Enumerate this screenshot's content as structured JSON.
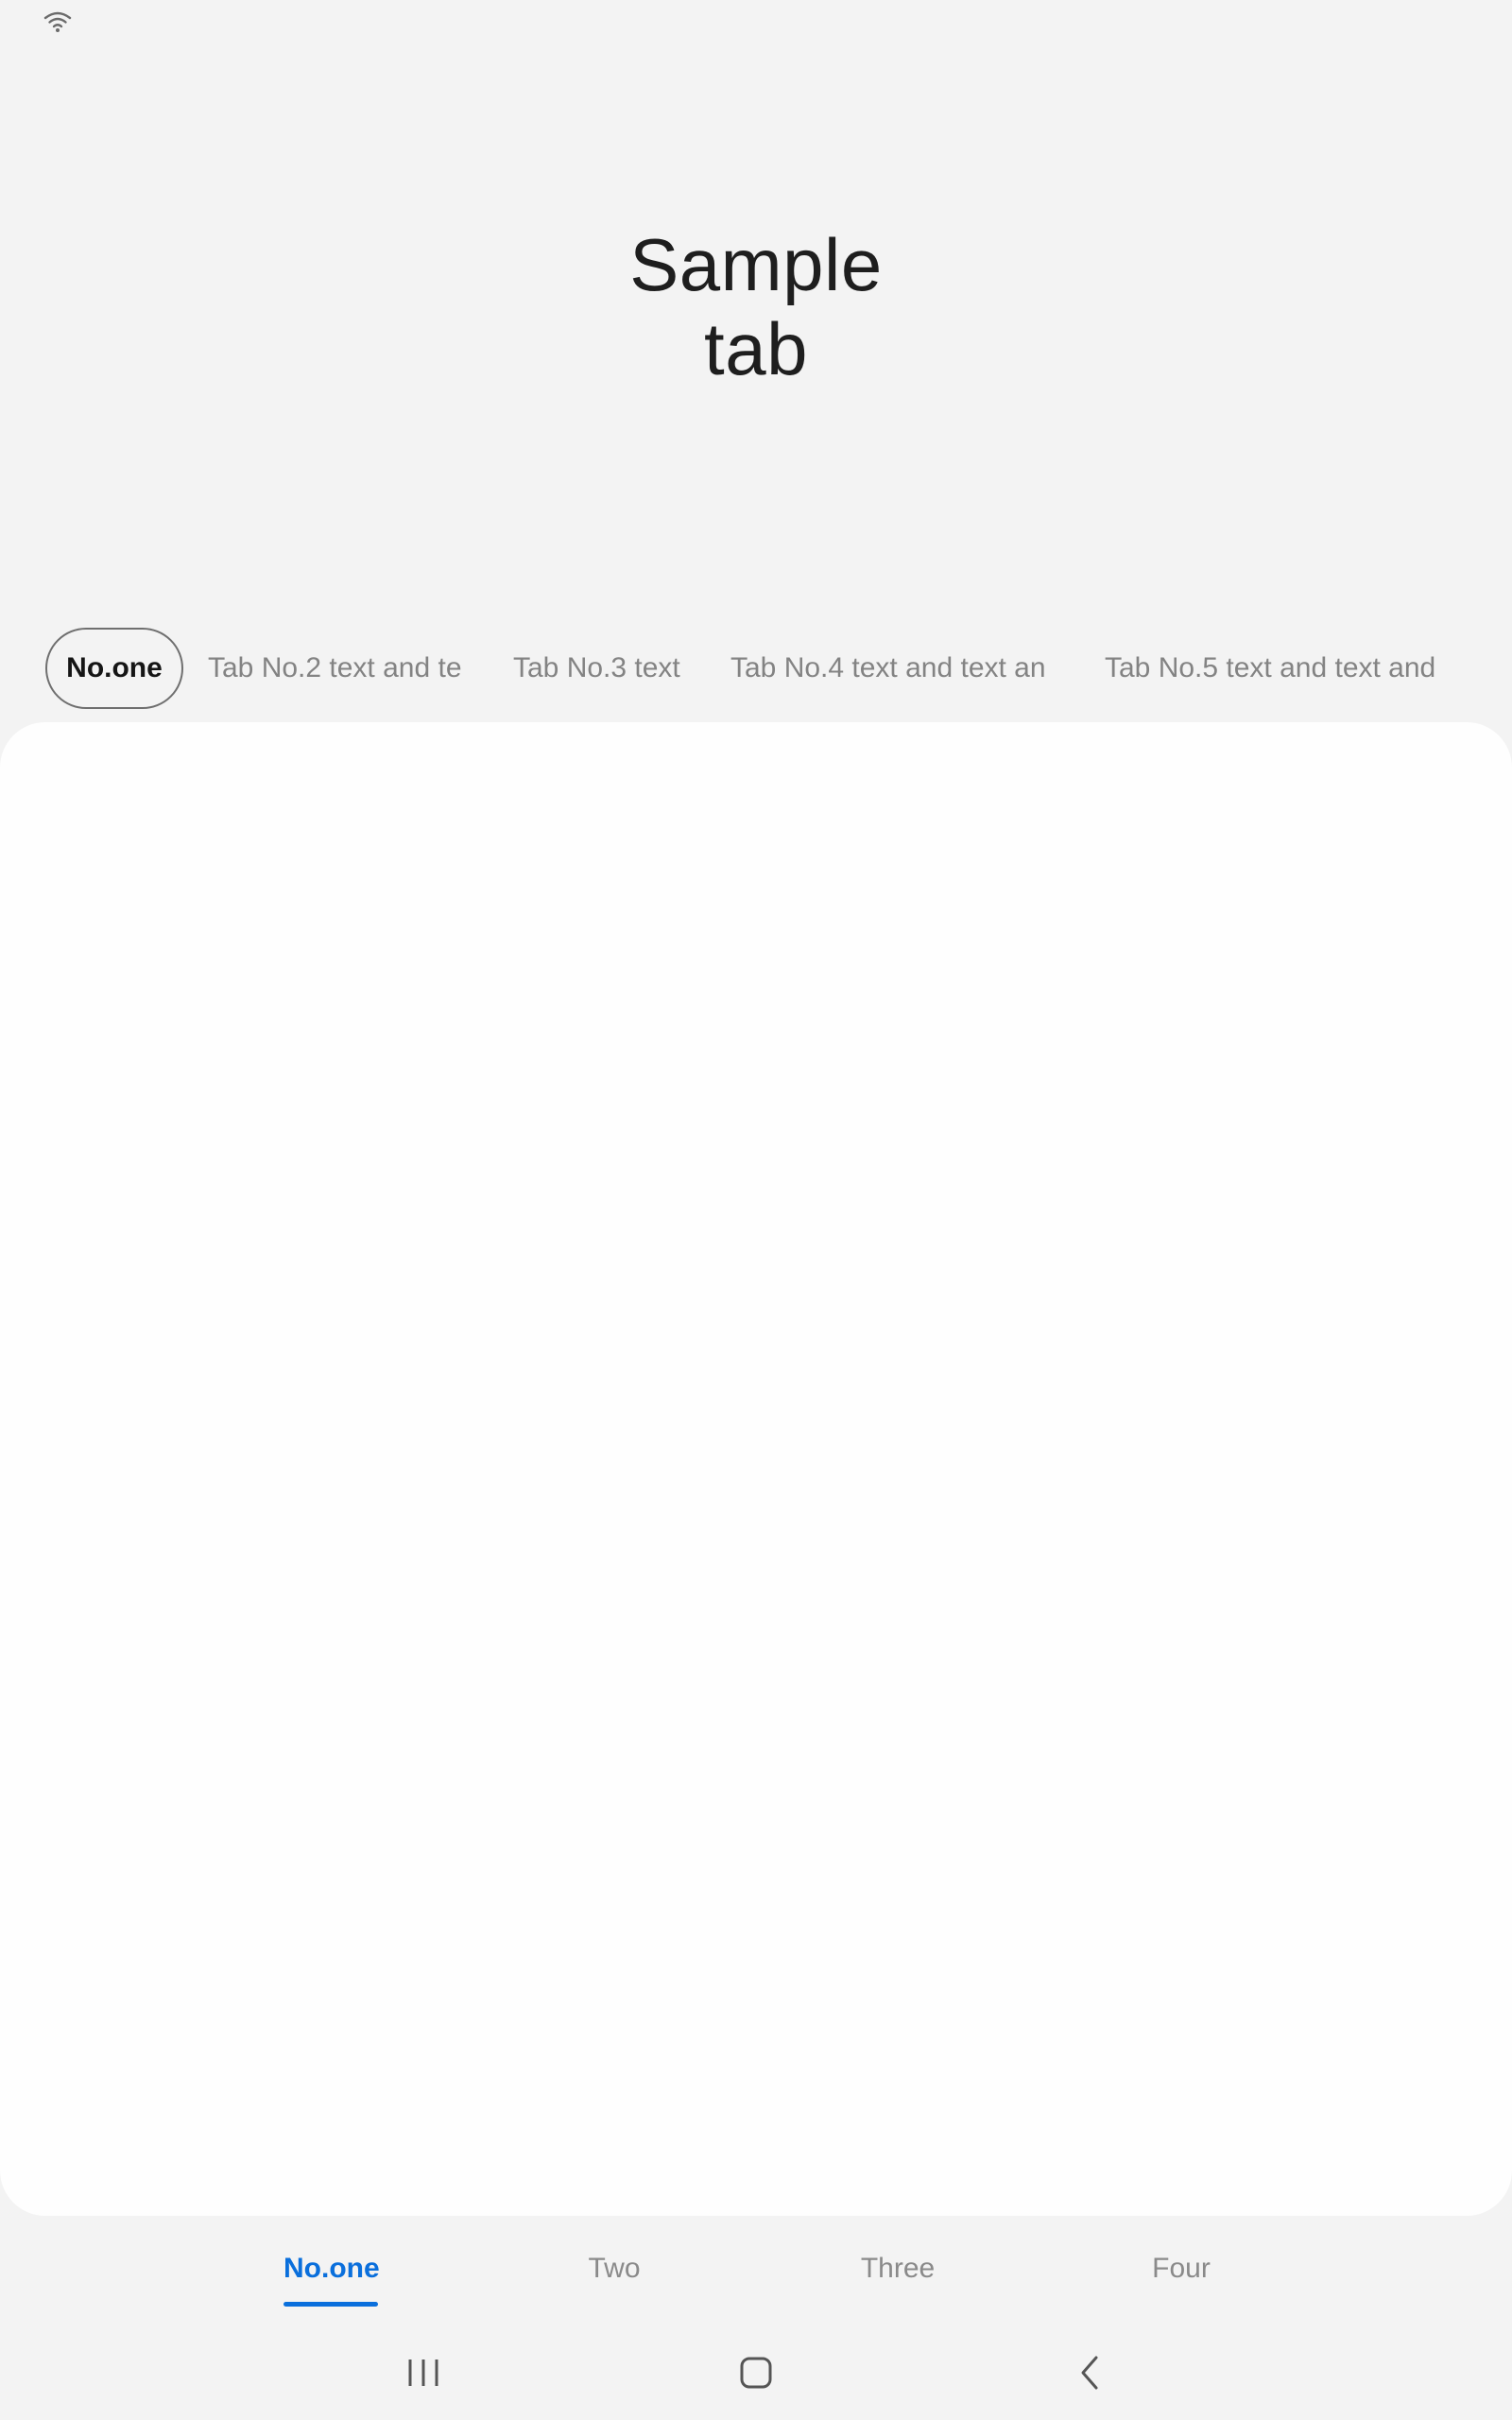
{
  "title": {
    "line1": "Sample",
    "line2": "tab"
  },
  "top_tabs": [
    {
      "label": "No.one",
      "selected": true
    },
    {
      "label": "Tab No.2 text and te",
      "selected": false
    },
    {
      "label": "Tab No.3 text",
      "selected": false
    },
    {
      "label": "Tab No.4 text and text an",
      "selected": false
    },
    {
      "label": "Tab No.5 text and text and",
      "selected": false
    }
  ],
  "bottom_tabs": [
    {
      "label": "No.one",
      "selected": true
    },
    {
      "label": "Two",
      "selected": false
    },
    {
      "label": "Three",
      "selected": false
    },
    {
      "label": "Four",
      "selected": false
    }
  ],
  "status_bar": {
    "icons": [
      "wifi-icon"
    ]
  },
  "nav_bar": {
    "icons": [
      "recent-apps-icon",
      "home-icon",
      "back-icon"
    ]
  },
  "colors": {
    "background": "#f3f3f3",
    "card": "#fefefe",
    "accent": "#0a6fdc",
    "selected_text": "#151515",
    "unselected_text": "#838383"
  }
}
